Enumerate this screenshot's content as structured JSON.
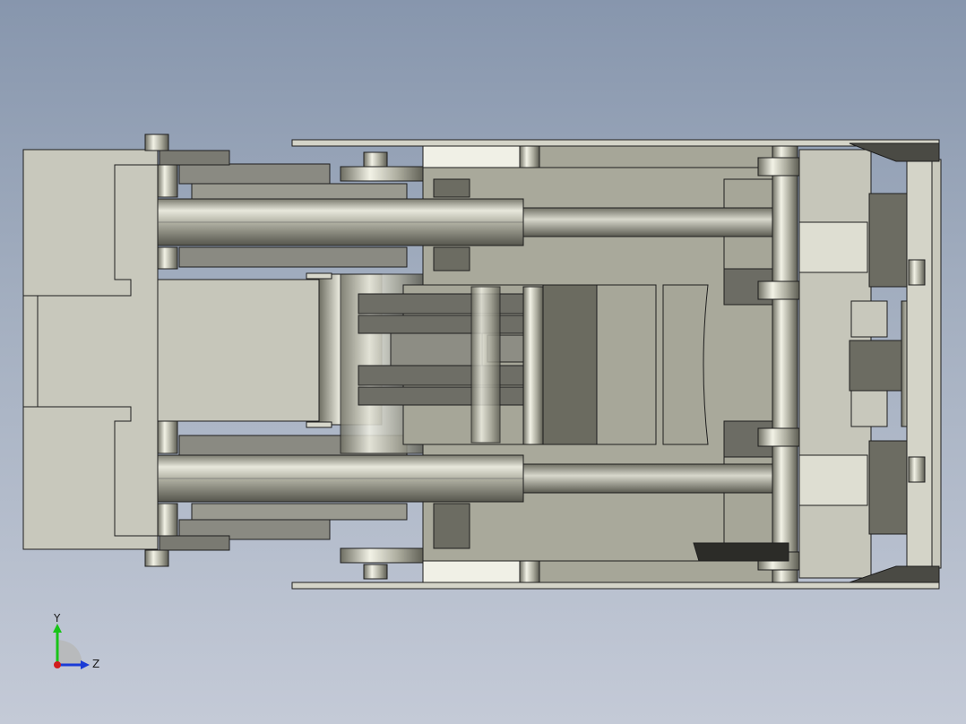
{
  "viewport": {
    "background_top": "#8796ad",
    "background_bottom": "#c4cad7",
    "model_shading": "gray-shaded-with-edges"
  },
  "triad": {
    "y_label": "Y",
    "z_label": "Z",
    "y_color": "#18c418",
    "z_color": "#1a3bd6",
    "x_color": "#d11d1d"
  }
}
